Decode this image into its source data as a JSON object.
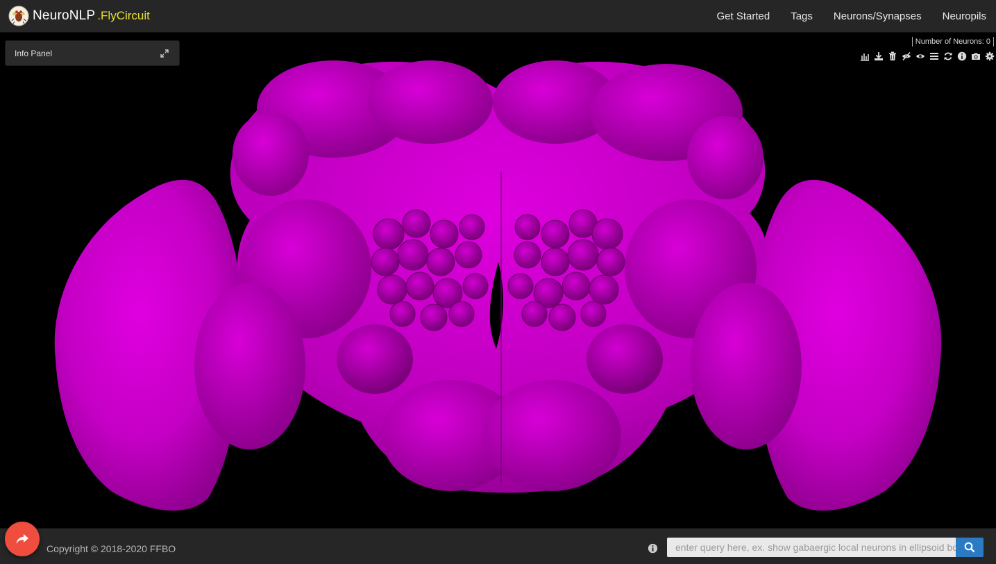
{
  "brand": {
    "name": "NeuroNLP",
    "sub": ".FlyCircuit"
  },
  "nav": [
    "Get Started",
    "Tags",
    "Neurons/Synapses",
    "Neuropils"
  ],
  "info_panel": {
    "title": "Info Panel"
  },
  "neuron_count": {
    "label": "Number of Neurons:",
    "value": "0",
    "text": "Number of Neurons: 0"
  },
  "toolbar_icons": [
    "bar-chart-icon",
    "download-icon",
    "trash-icon",
    "eye-slash-icon",
    "eye-icon",
    "list-icon",
    "refresh-icon",
    "info-circle-icon",
    "camera-icon",
    "gear-icon"
  ],
  "viewer": {
    "mesh_color": "#cc00cc",
    "background": "#000000"
  },
  "footer": {
    "copyright": "Copyright © 2018-2020 FFBO",
    "query_placeholder": "enter query here, ex. show gabaergic local neurons in ellipsoid body"
  },
  "colors": {
    "navbar": "#262626",
    "brand_sub": "#e8e030",
    "share_button": "#ef4d3d",
    "search_button": "#2a7ac4"
  }
}
